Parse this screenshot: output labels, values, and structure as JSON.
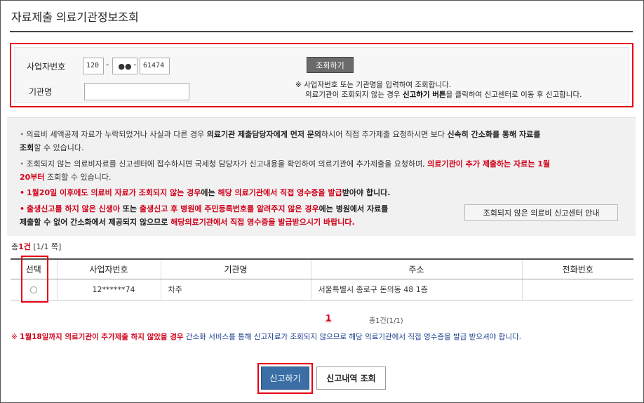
{
  "title": "자료제출 의료기관정보조회",
  "search": {
    "biz_no_label": "사업자번호",
    "biz_no_part1": "120",
    "biz_no_part2": "●●",
    "biz_no_part3": "61474",
    "institution_label": "기관명",
    "institution_value": "",
    "search_button": "조회하기",
    "note_line1": "※ 사업자번호 또는 기관명을 입력하여 조회합니다.",
    "note_line2_pre": "의료기관이 조회되지 않는 경우 ",
    "note_line2_bold": "신고하기 버튼",
    "note_line2_post": "을 클릭하여 신고센터로 이동 후 신고합니다."
  },
  "notice": {
    "p1_a": "의료비 세액공제 자료가 누락되었거나 사실과 다른 경우 ",
    "p1_b": "의료기관 제출담당자에게 먼저 문의",
    "p1_c": "하시어 직접 추가제출 요청하시면 보다 ",
    "p1_d": "신속히 간소화를 통해 자료를",
    "p1_e": "조회",
    "p1_f": "할 수 있습니다.",
    "p2_a": "조회되지 않는 의료비자료를 신고센터에 접수하시면 국세청 담당자가 신고내용을 확인하여 의료기관에 추가제출을 요청하며, ",
    "p2_b": "의료기관이 추가 제출하는 자료는 1월",
    "p2_c": "20부터",
    "p2_d": " 조회할 수 있습니다.",
    "p3_a": "1월20일 이후에도 의료비 자료가 조회되지 않는 경우",
    "p3_b": "에는 ",
    "p3_c": "해당 의료기관에서 직접 영수증을 발급",
    "p3_d": "받아야 합니다.",
    "p4_a": "출생신고를 하지 않은 신생아",
    "p4_b": " 또는 ",
    "p4_c": "출생신고 후 병원에 주민등록번호를 알려주지 않은 경우",
    "p4_d": "에는 병원에서 자료를",
    "p4_e": "제출할 수 없어 간소화에서 제공되지 않으므로 ",
    "p4_f": "해당의료기관에서 직접 영수증을 발급받으시기 바랍니다.",
    "center_button": "조회되지 않은 의료비 신고센터 안내"
  },
  "result": {
    "count_pre": "총",
    "count_num": "1건",
    "count_post": " [1/1 쪽]",
    "headers": [
      "선택",
      "사업자번호",
      "기관명",
      "주소",
      "전화번호"
    ],
    "rows": [
      {
        "biz_no": "12******74",
        "name": "차주",
        "address": "서울특별시 종로구 돈의동 48 1층",
        "tel": ""
      }
    ]
  },
  "pager": {
    "current": "1",
    "info": "총1건(1/1)"
  },
  "bottom_note": {
    "mark": "※ ",
    "red": "1월18일까지  의료기관이 추가제출 하지 않았을 경우",
    "rest": " 간소화 서비스를 통해 신고자료가 조회되지 않으므로 해당 의료기관에서 직접 영수증을 발급 받으셔야 합니다."
  },
  "buttons": {
    "report": "신고하기",
    "history": "신고내역 조회"
  },
  "colors": {
    "highlight": "#e60012",
    "primary_button": "#3a6ea5",
    "emphasis_red": "#d0021b"
  }
}
